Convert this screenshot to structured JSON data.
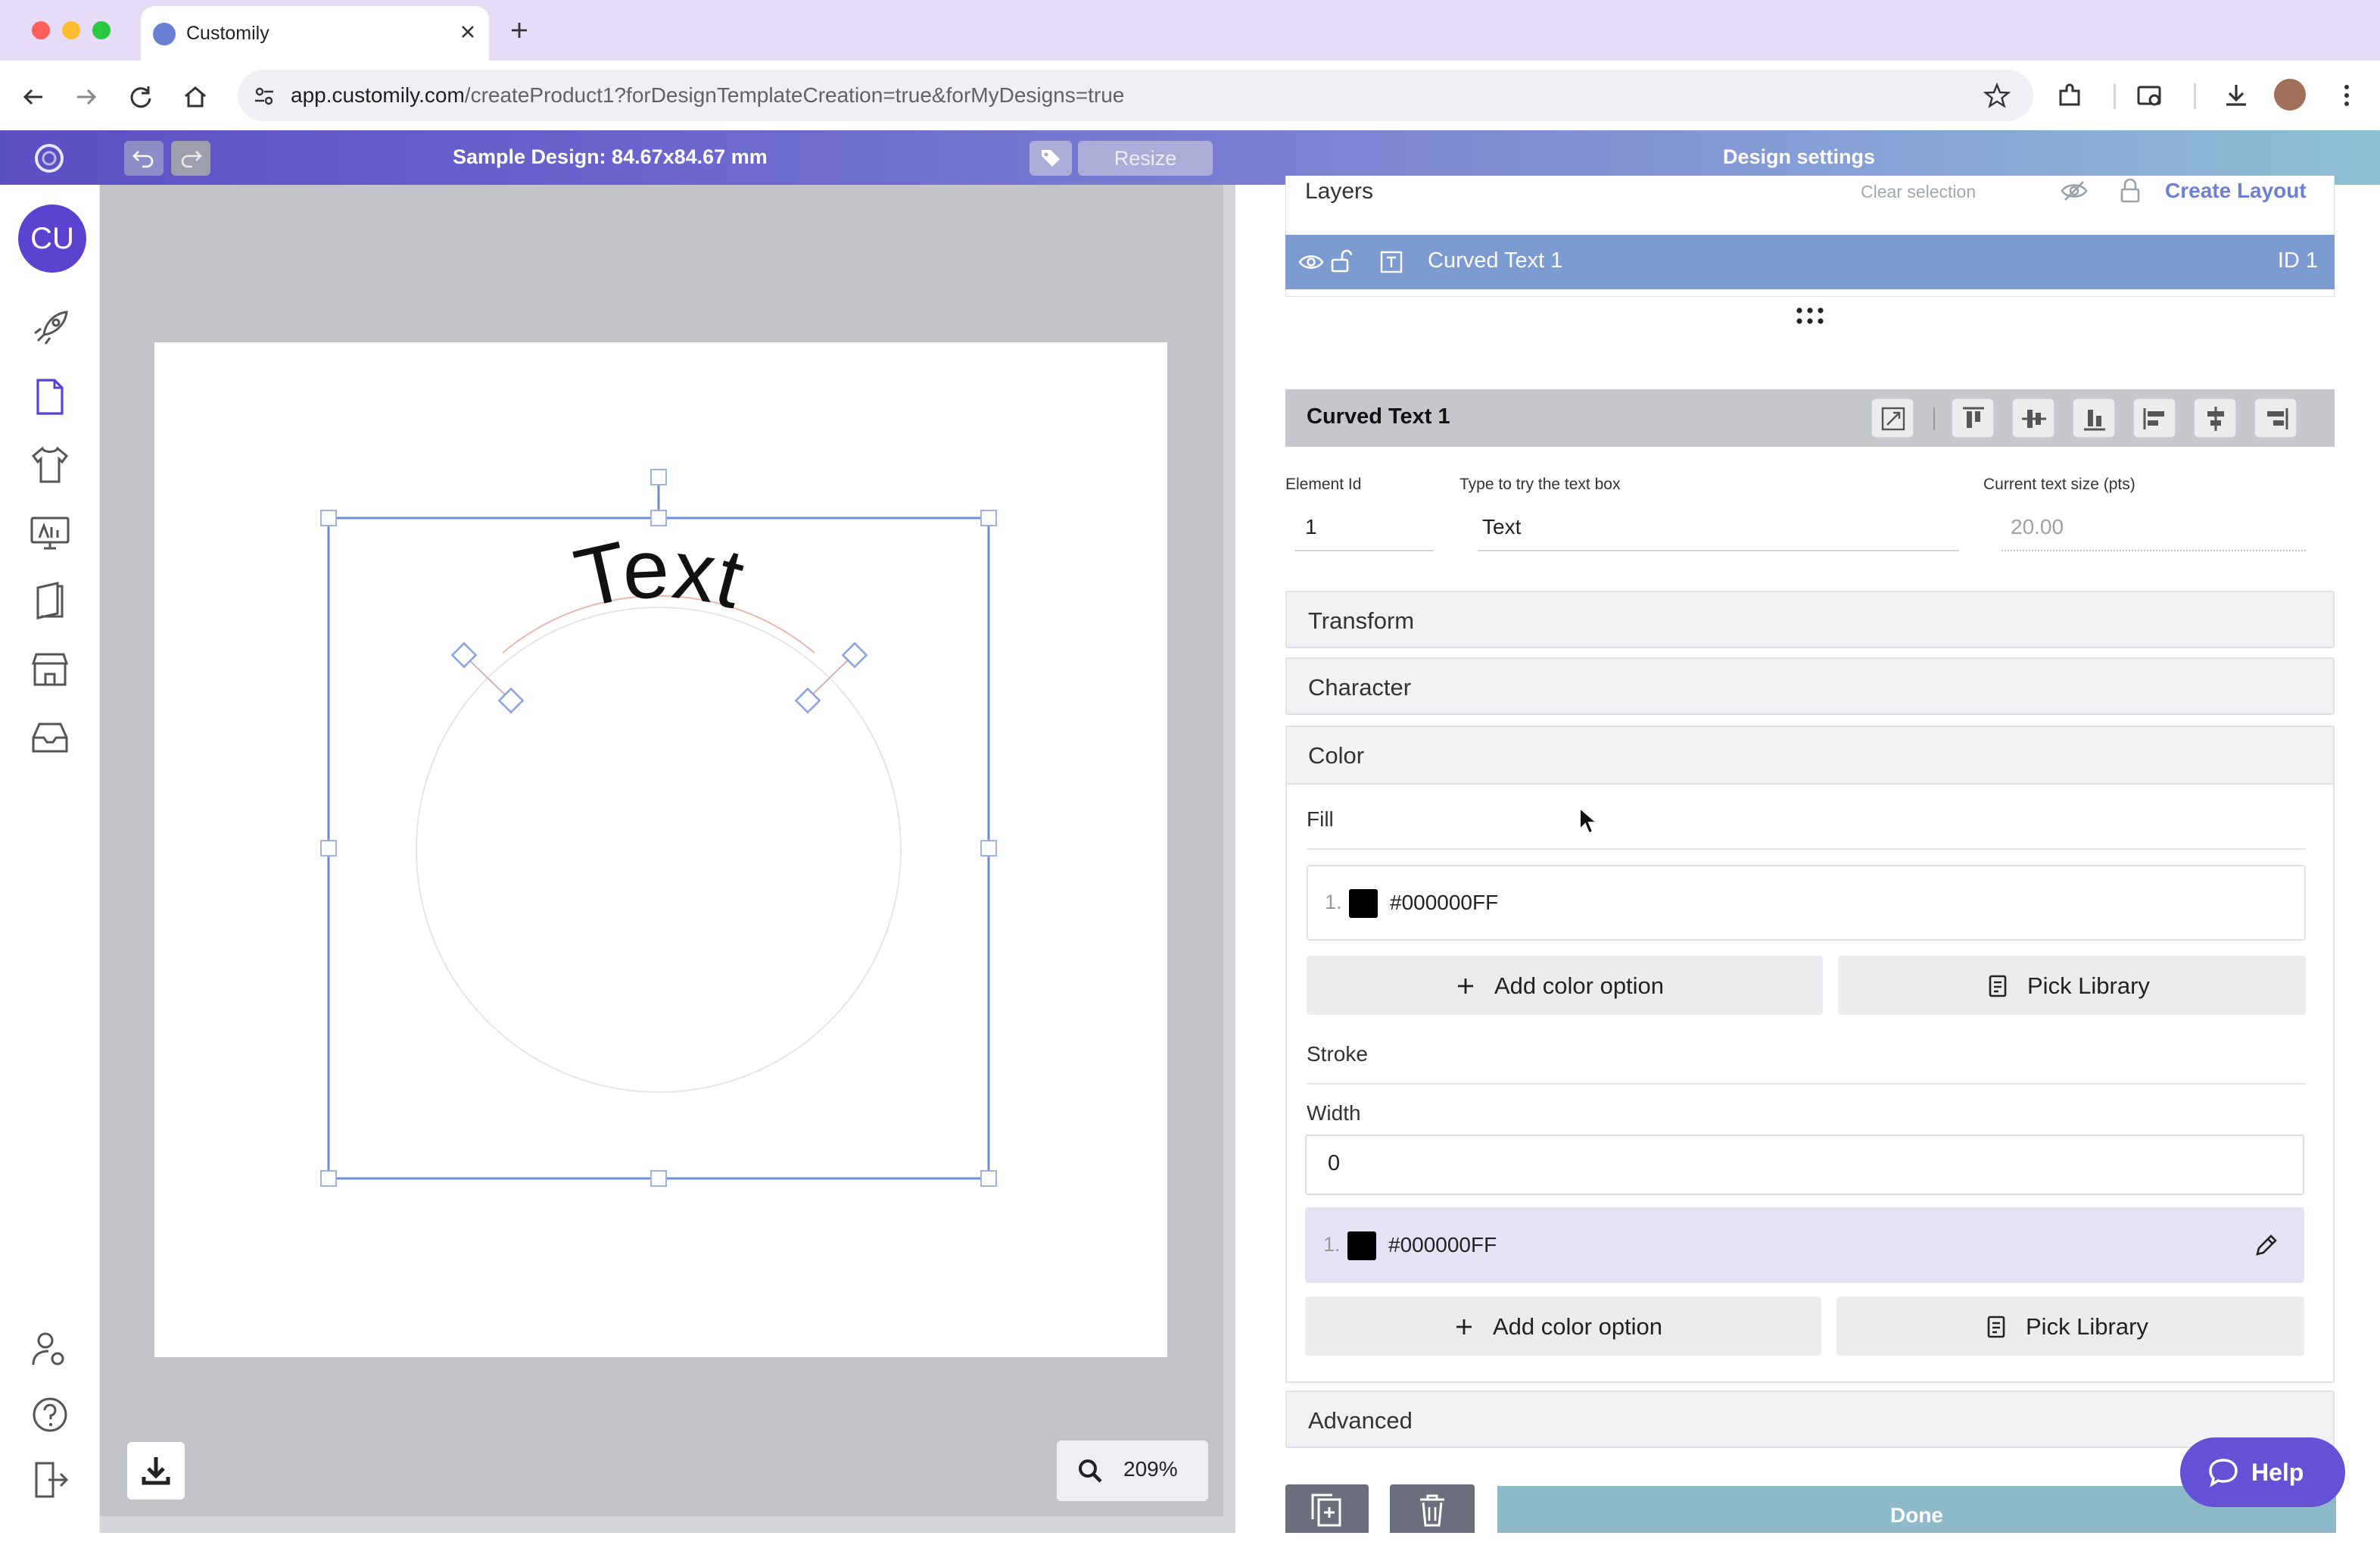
{
  "browser": {
    "tab_title": "Customily",
    "url_host": "app.customily.com",
    "url_path": "/createProduct1?forDesignTemplateCreation=true&forMyDesigns=true"
  },
  "header": {
    "design_title": "Sample Design: 84.67x84.67 mm",
    "resize_label": "Resize",
    "design_settings_title": "Design settings"
  },
  "nav": {
    "avatar_initials": "CU"
  },
  "canvas": {
    "curved_text": "Text",
    "zoom_value": "209%"
  },
  "layers": {
    "title": "Layers",
    "clear_selection": "Clear selection",
    "create_layout": "Create Layout",
    "rows": [
      {
        "name": "Curved Text 1",
        "id_label": "ID 1"
      }
    ]
  },
  "element": {
    "title": "Curved Text 1",
    "element_id_label": "Element Id",
    "element_id_value": "1",
    "text_box_label": "Type to try the text box",
    "text_box_value": "Text",
    "text_size_label": "Current text size (pts)",
    "text_size_value": "20.00"
  },
  "sections": {
    "transform": "Transform",
    "character": "Character",
    "color": "Color",
    "advanced": "Advanced"
  },
  "color": {
    "fill_label": "Fill",
    "fill_options": [
      {
        "index": "1.",
        "hex": "#000000FF",
        "swatch": "#000000"
      }
    ],
    "add_color_option": "Add color option",
    "pick_library": "Pick Library",
    "stroke_label": "Stroke",
    "width_label": "Width",
    "width_value": "0",
    "stroke_options": [
      {
        "index": "1.",
        "hex": "#000000FF",
        "swatch": "#000000"
      }
    ]
  },
  "footer": {
    "done_label": "Done",
    "help_label": "Help"
  },
  "colors": {
    "accent": "#5b43cf",
    "layer_selected": "#7c9bd1",
    "help": "#6551d6",
    "done": "#8db9c8"
  }
}
